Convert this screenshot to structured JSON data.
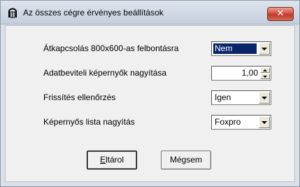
{
  "window": {
    "title": "Az összes cégre érvényes beállítások",
    "close_label": "✕"
  },
  "settings": [
    {
      "label": "Átkapcsolás 800x600-as felbontásra",
      "value": "Nem",
      "control": "combo",
      "selected": true
    },
    {
      "label": "Adatbeviteli képernyők nagyítása",
      "value": "1,00",
      "control": "spinner"
    },
    {
      "label": "Frissítés ellenőrzés",
      "value": "Igen",
      "control": "combo"
    },
    {
      "label": "Képernyős lista nagyítás",
      "value": "Foxpro",
      "control": "combo"
    }
  ],
  "buttons": {
    "save_accel": "E",
    "save_rest": "ltárol",
    "cancel": "Mégsem"
  },
  "icons": {
    "title": "gate-icon",
    "combo_arrow": "chevron-down-icon"
  },
  "colors": {
    "selection": "#0a246a",
    "close_button": "#c0392b"
  }
}
